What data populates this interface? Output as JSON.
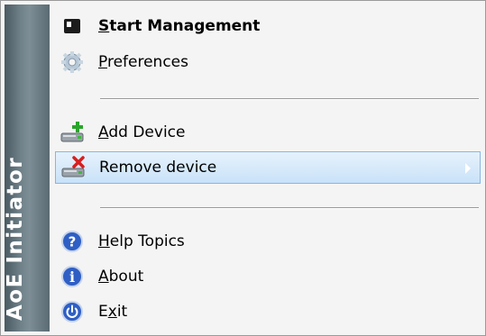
{
  "banner": {
    "title": "AoE Initiator"
  },
  "menu": {
    "items": [
      {
        "pre": "",
        "mn": "S",
        "post": "tart Management"
      },
      {
        "pre": "",
        "mn": "P",
        "post": "references"
      },
      {
        "pre": "",
        "mn": "A",
        "post": "dd Device"
      },
      {
        "pre": "Remove device",
        "mn": "",
        "post": ""
      },
      {
        "pre": "",
        "mn": "H",
        "post": "elp Topics"
      },
      {
        "pre": "",
        "mn": "A",
        "post": "bout"
      },
      {
        "pre": "E",
        "mn": "x",
        "post": "it"
      }
    ]
  },
  "colors": {
    "banner": "#6f8088",
    "highlight": "#c9e2f8",
    "highlight_border": "#88b6e2"
  }
}
